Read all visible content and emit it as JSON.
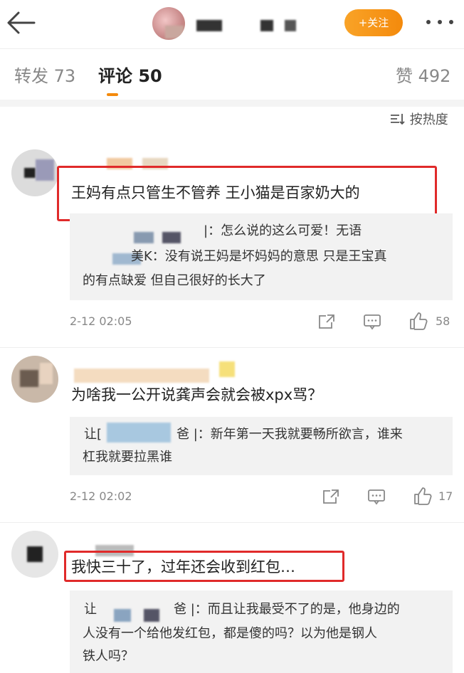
{
  "header": {
    "back_icon": "back-arrow-icon",
    "follow_label": "+关注",
    "more_icon": "more-dots-icon"
  },
  "tabs": [
    {
      "label": "转发 73"
    },
    {
      "label": "评论 50"
    },
    {
      "label": "赞 492"
    }
  ],
  "sort_label": "按热度",
  "comments": [
    {
      "text": "王妈有点只管生不管养 王小猫是百家奶大的",
      "replies": [
        "|：怎么说的这么可爱！无语",
        "美K：没有说王妈是坏妈妈的意思 只是王宝真",
        "的有点缺爱 但自己很好的长大了"
      ],
      "time": "2-12 02:05",
      "likes": "58"
    },
    {
      "text": "为啥我一公开说龚声会就会被xpx骂？",
      "replies": [
        "让[",
        "爸 |：新年第一天我就要畅所欲言，谁来",
        "杠我就要拉黑谁"
      ],
      "time": "2-12 02:02",
      "likes": "17"
    },
    {
      "text": "我快三十了，过年还会收到红包…",
      "replies": [
        "让",
        "爸 |：而且让我最受不了的是，他身边的",
        "人没有一个给他发红包，都是傻的吗？以为他是钢人",
        "铁人吗？"
      ]
    }
  ],
  "colors": {
    "accent": "#f48a0c",
    "highlight": "#e02a2a"
  }
}
